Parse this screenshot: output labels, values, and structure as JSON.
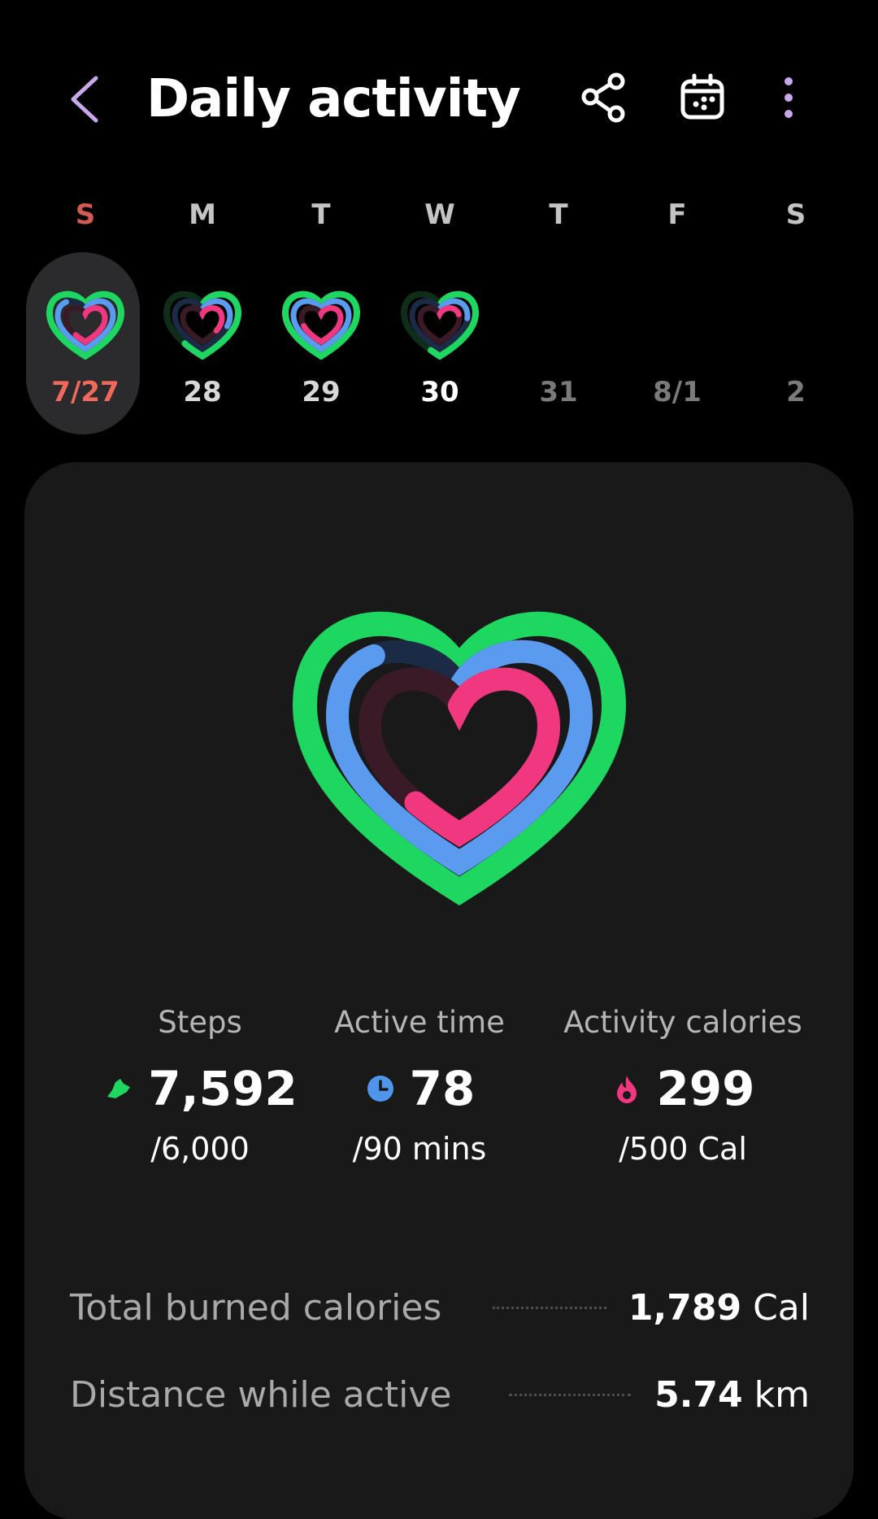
{
  "header": {
    "title": "Daily activity",
    "back_icon": "chevron-left-icon",
    "share_icon": "share-icon",
    "calendar_icon": "calendar-icon",
    "more_icon": "more-vertical-icon",
    "accent_color": "#c9a8f0"
  },
  "week": {
    "days": [
      {
        "letter": "S",
        "date": "7/27",
        "selected": true,
        "steps_pct": 1.0,
        "active_pct": 0.87,
        "cal_pct": 0.6
      },
      {
        "letter": "M",
        "date": "28",
        "selected": false,
        "steps_pct": 0.6,
        "active_pct": 0.3,
        "cal_pct": 0.35
      },
      {
        "letter": "T",
        "date": "29",
        "selected": false,
        "steps_pct": 1.0,
        "active_pct": 1.0,
        "cal_pct": 0.7
      },
      {
        "letter": "W",
        "date": "30",
        "selected": false,
        "steps_pct": 0.55,
        "active_pct": 0.25,
        "cal_pct": 0.2
      },
      {
        "letter": "T",
        "date": "31",
        "selected": false
      },
      {
        "letter": "F",
        "date": "8/1",
        "selected": false
      },
      {
        "letter": "S",
        "date": "2",
        "selected": false
      }
    ]
  },
  "rings": {
    "steps_pct": 1.0,
    "active_pct": 0.867,
    "cal_pct": 0.598,
    "colors": {
      "steps": "#1ed760",
      "active": "#5a9bf0",
      "calories": "#f0377f"
    }
  },
  "stats": {
    "steps": {
      "label": "Steps",
      "value": "7,592",
      "goal": "/6,000",
      "icon": "shoe-icon"
    },
    "active_time": {
      "label": "Active time",
      "value": "78",
      "goal": "/90 mins",
      "icon": "clock-icon"
    },
    "calories": {
      "label": "Activity calories",
      "value": "299",
      "goal": "/500 Cal",
      "icon": "flame-icon"
    }
  },
  "summary": {
    "burned": {
      "label": "Total burned calories",
      "value": "1,789",
      "unit": "Cal"
    },
    "distance": {
      "label": "Distance while active",
      "value": "5.74",
      "unit": "km"
    }
  }
}
